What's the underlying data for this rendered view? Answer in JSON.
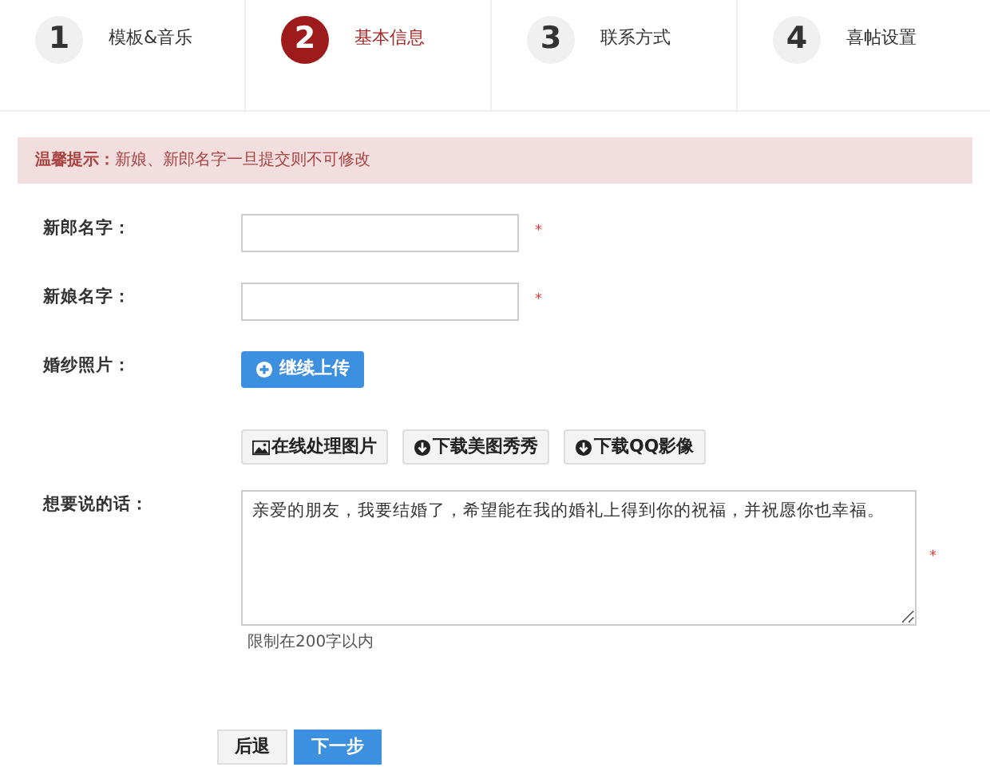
{
  "steps": [
    {
      "number": "1",
      "label": "模板&音乐",
      "selected": false
    },
    {
      "number": "2",
      "label": "基本信息",
      "selected": true
    },
    {
      "number": "3",
      "label": "联系方式",
      "selected": false
    },
    {
      "number": "4",
      "label": "喜帖设置",
      "selected": false
    }
  ],
  "notice": "**温馨提示：**新娘、新郎名字一旦提交则不可修改",
  "fields": [
    {
      "kind": "text",
      "label": "新郎名字：",
      "required_mark": "*"
    },
    {
      "kind": "text",
      "label": "新娘名字：",
      "required_mark": "*"
    },
    {
      "kind": "upload",
      "label": "婚纱照片：",
      "button": "继续上传",
      "tools": [
        {
          "kind": "image",
          "label": "在线处理图片"
        },
        {
          "kind": "download",
          "label": "下载美图秀秀"
        },
        {
          "kind": "download",
          "label": "下载QQ影像"
        }
      ]
    },
    {
      "kind": "textarea",
      "label": "想要说的话：",
      "value": "亲爱的朋友，我要结婚了，希望能在我的婚礼上得到你的祝福，并祝愿你也幸福。",
      "required_mark": "*",
      "hint": "限制在200字以内"
    }
  ],
  "actions": [
    {
      "kind": "secondary",
      "label": "后退"
    },
    {
      "kind": "primary",
      "label": "下一步"
    }
  ]
}
